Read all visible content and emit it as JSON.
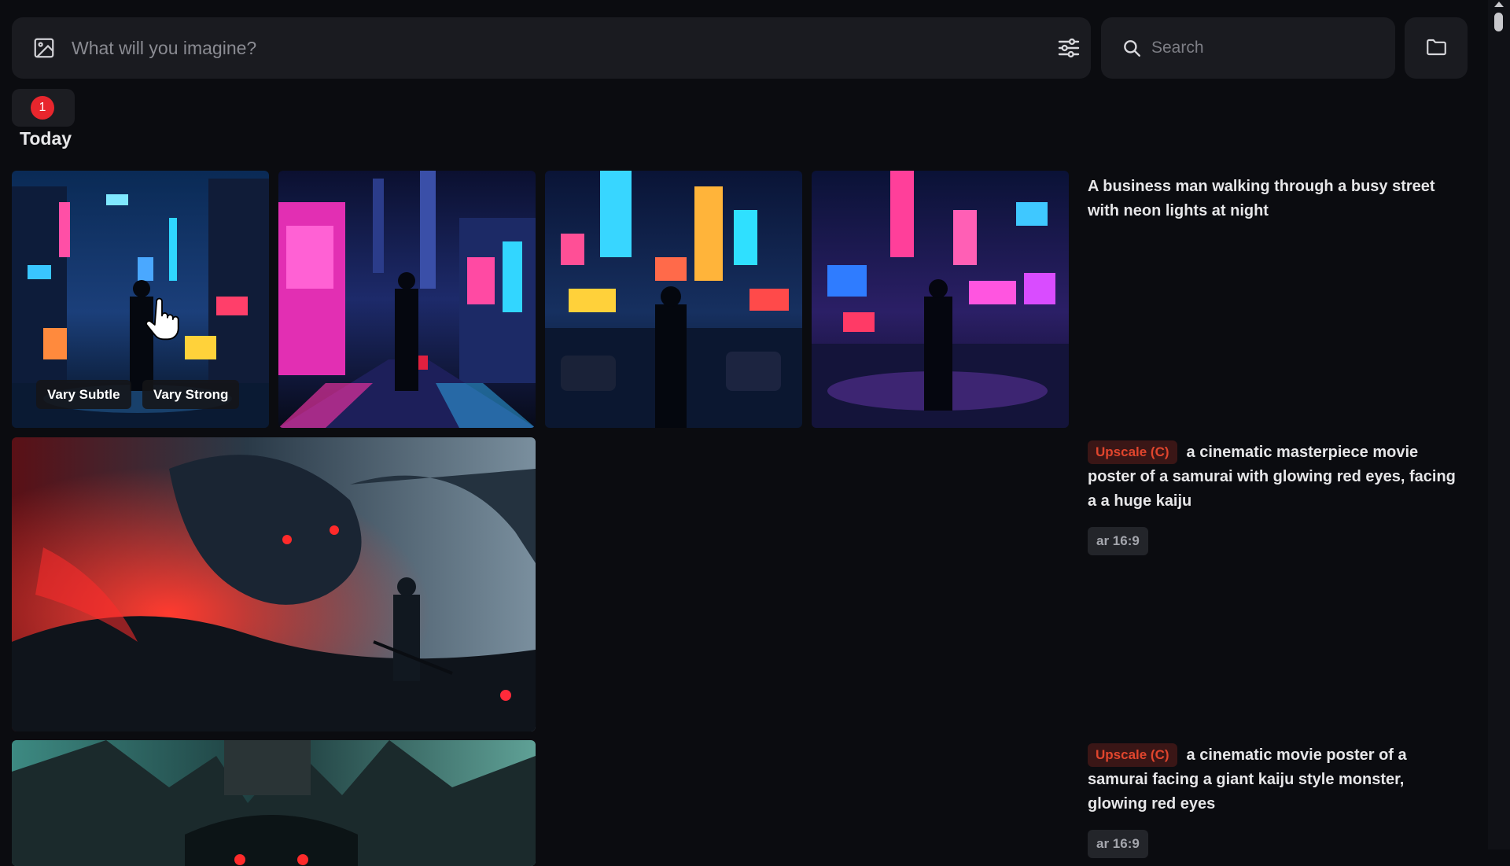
{
  "prompt_bar": {
    "placeholder": "What will you imagine?",
    "image_icon": "image-icon",
    "settings_icon": "sliders-icon"
  },
  "search": {
    "placeholder": "Search",
    "icon": "search-icon"
  },
  "folder_icon": "folder-icon",
  "day_group": {
    "count": "1",
    "label": "Today"
  },
  "jobs": [
    {
      "prompt": "A business man walking through a busy street with neon lights at night",
      "variation_buttons": [
        "Vary Subtle",
        "Vary Strong"
      ],
      "images": [
        "neon-city-street-1",
        "neon-city-street-2",
        "neon-city-street-3",
        "neon-city-street-4"
      ]
    },
    {
      "tag": "Upscale (C)",
      "prompt": "a cinematic masterpiece movie poster of a samurai with glowing red eyes, facing a a huge kaiju",
      "aspect": "ar 16:9",
      "images": [
        "samurai-vs-dragon-red"
      ]
    },
    {
      "tag": "Upscale (C)",
      "prompt": "a cinematic movie poster of a samurai facing a giant kaiju style monster, glowing red eyes",
      "aspect": "ar 16:9",
      "images": [
        "kaiju-monster-green"
      ]
    }
  ],
  "colors": {
    "background": "#0b0c10",
    "panel": "#1a1b20",
    "badge_red": "#e8262d",
    "upscale_text": "#e0452d"
  }
}
